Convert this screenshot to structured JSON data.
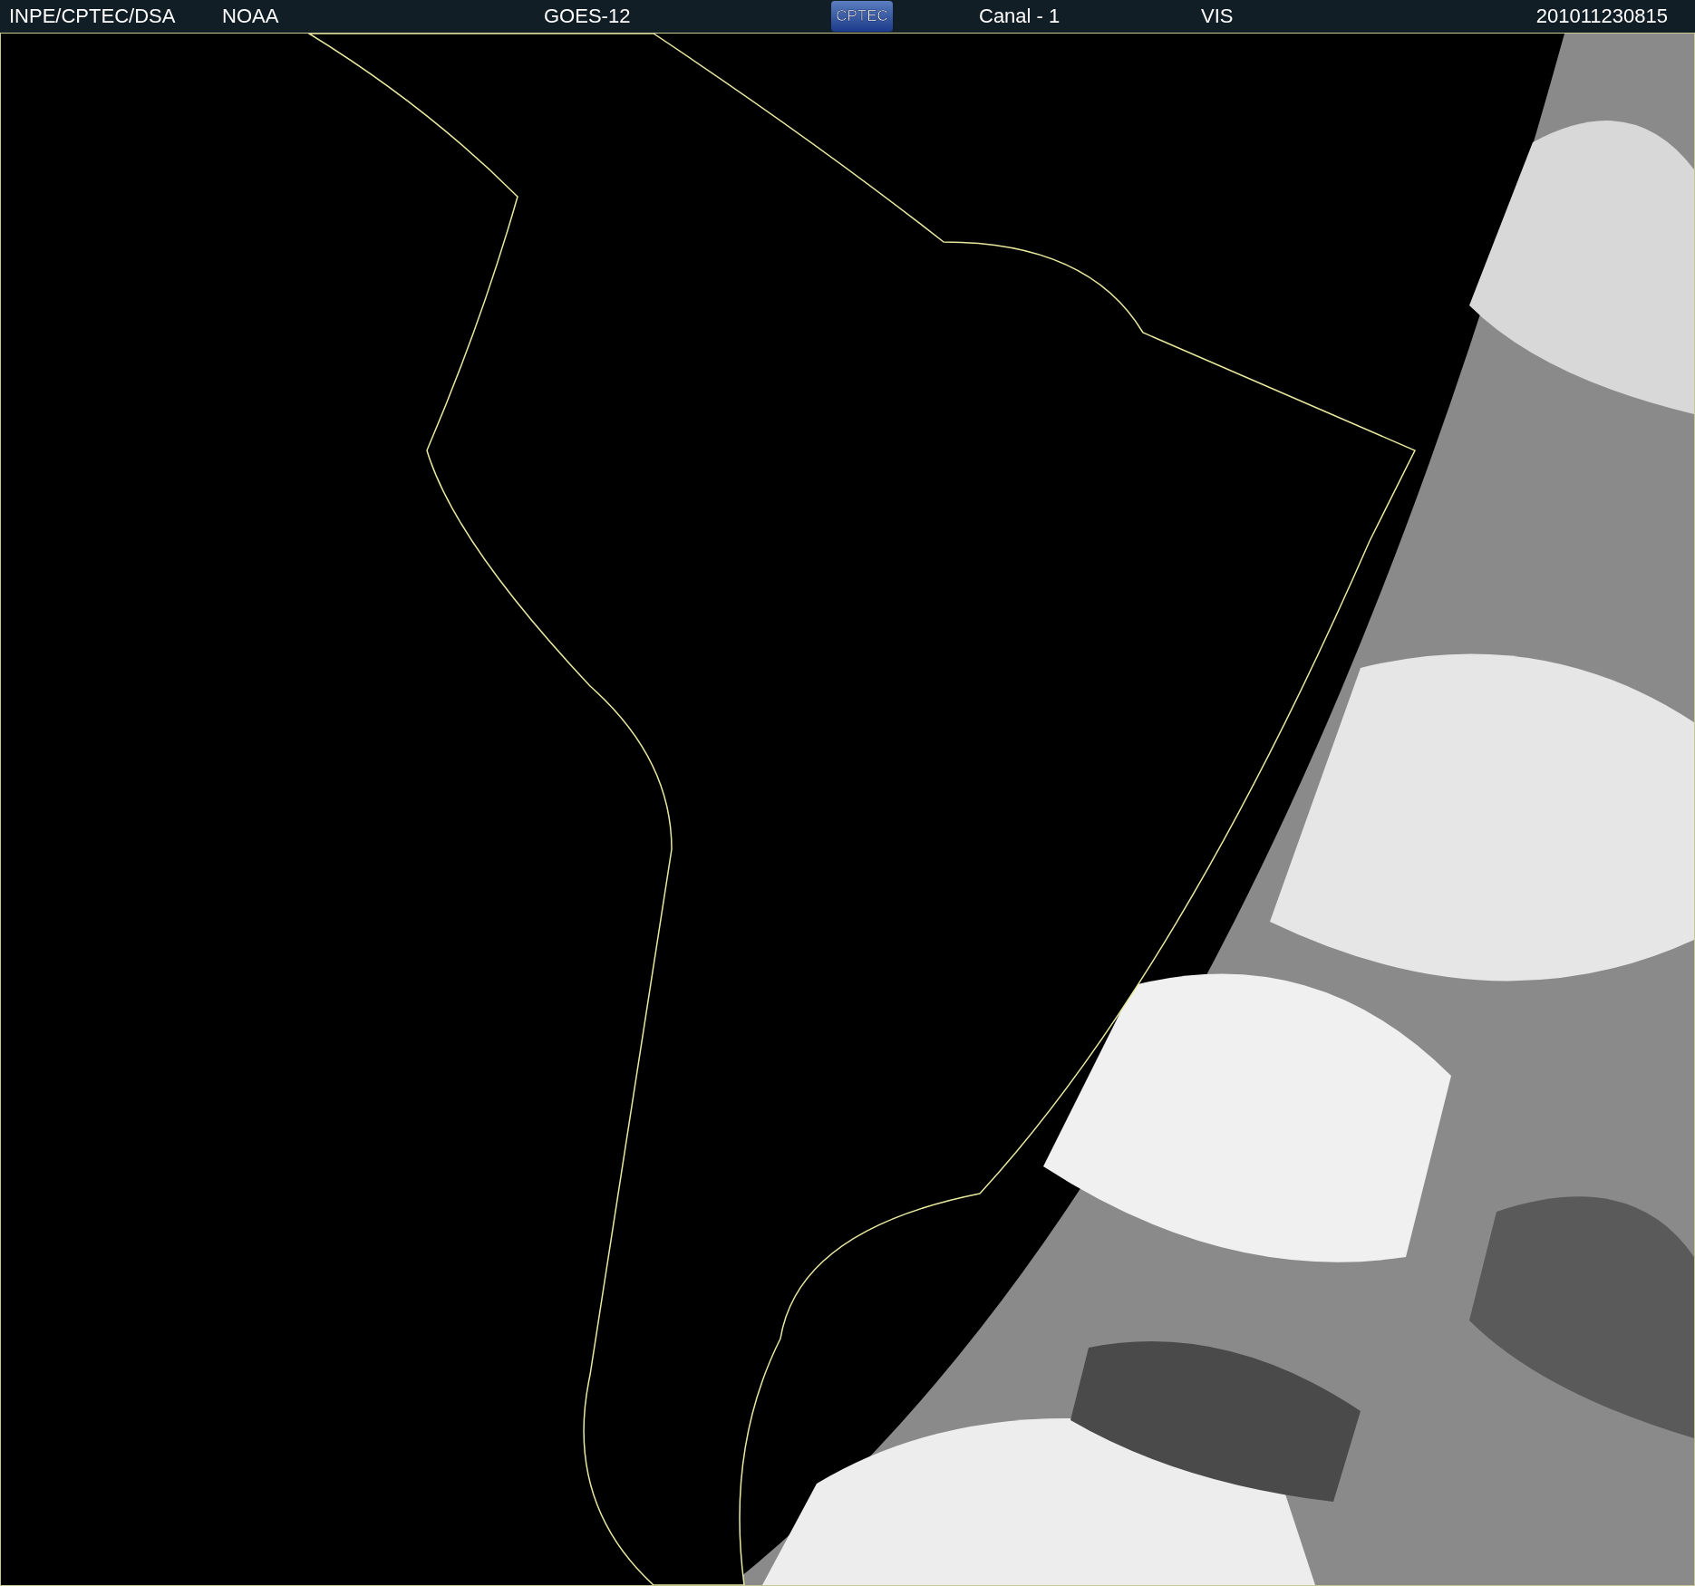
{
  "header": {
    "source": "INPE/CPTEC/DSA",
    "agency": "NOAA",
    "satellite": "GOES-12",
    "logo_text": "CPTEC",
    "channel": "Canal - 1",
    "band": "VIS",
    "timestamp": "201011230815"
  }
}
